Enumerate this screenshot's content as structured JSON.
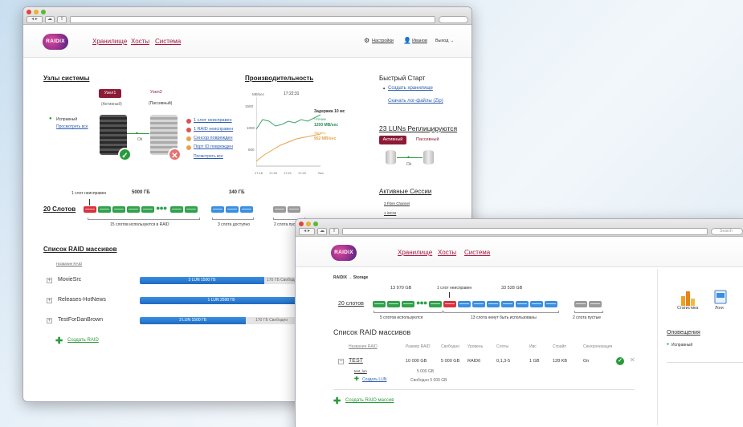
{
  "w1": {
    "nav": [
      "Хранилище",
      "Хосты",
      "Система"
    ],
    "logo": "RAIDIX",
    "user": {
      "settings": "Настройки",
      "name": "Иванов",
      "logout": "Выход →"
    },
    "nodes": {
      "title": "Узлы системы",
      "node1": "Узел1",
      "node1_state": "(Активный)",
      "node2": "Узел2",
      "node2_state": "(Пассивный)",
      "status": "Исправный",
      "view_all": "Просмотреть все",
      "ok": "Ok",
      "errors": [
        "1 слот неисправен",
        "1 RAID неисправен",
        "Сенсор поврежден",
        "Порт ID поврежден"
      ],
      "view_all2": "Посмотреть все"
    },
    "perf": {
      "title": "Производительность",
      "unit": "MB/sec",
      "time": "17:22:31",
      "y": [
        "1500",
        "1000",
        "500"
      ],
      "x": [
        "17:16",
        "17:20",
        "17:21",
        "17:22",
        "Sec"
      ],
      "delay": "Задержка 10 мс",
      "read_lbl": "Чтение",
      "read_val": "1200 MB/sec",
      "write_lbl": "Запись",
      "write_val": "952 MB/sec"
    },
    "quick": {
      "title": "Быстрый Старт",
      "create": "Создать хранилище",
      "logs": "Скачать лог-файлы (Zip)"
    },
    "luns": {
      "title": "23 LUNs Реплицируются",
      "active": "Активный",
      "passive": "Пассивный",
      "ok": "Ok"
    },
    "sessions": {
      "title": "Активные Сессии",
      "items": [
        "3 Fibre Channel",
        "1 iSCSI"
      ]
    },
    "slots": {
      "title": "20 Слотов",
      "broken": "1 слот неисправен",
      "gb1": "5000 ГБ",
      "gb2": "340 ГБ",
      "used": "15 слотов используются в RAID",
      "free": "3 слота доступно",
      "empty": "2 слота пустые"
    },
    "raid": {
      "title": "Список RAID массивов",
      "col": "Название RAID",
      "rows": [
        {
          "name": "MovieSrc",
          "bar": "3 LUN  1500 ГБ",
          "free": "170 ГБ Свободно"
        },
        {
          "name": "Releases-HotNews",
          "bar": "1 LUN  2500 ГБ",
          "free": ""
        },
        {
          "name": "TestForDanBrown",
          "bar": "3 LUN  1500 ГБ",
          "free": "170 ГБ Свободно"
        }
      ],
      "create": "Создать RAID"
    }
  },
  "w2": {
    "nav": [
      "Хранилище",
      "Хосты",
      "Система"
    ],
    "logo": "RAIDIX",
    "breadcrumb": "RAIDIX → Storage",
    "search": "Search",
    "slots": {
      "title": "20 слотов",
      "gb1": "13 970 GB",
      "broken": "1 слот неисправен",
      "gb2": "33 528 GB",
      "used": "5 слотов используются",
      "used2": "13 слота неиут быть использованы",
      "empty": "2 слота пустые"
    },
    "raid_title": "Список RAID массивов",
    "cols": [
      "Название RAID",
      "Размер RAID",
      "Свободно",
      "Уровень",
      "Слоты",
      "Ивс",
      "Страйп",
      "Синхронизация"
    ],
    "row": {
      "name": "TEST",
      "size": "10 000 GB",
      "free": "5 000 GB",
      "level": "RAID6",
      "slots": "0,1,3-5",
      "lun": "1 GB",
      "stripe": "128 KB",
      "sync": "On"
    },
    "sub": {
      "name": "test_lun",
      "val": "5 000 GB",
      "create": "Создать LUN",
      "free": "Свободно 5 000 GB"
    },
    "create": "Создать RAID массив",
    "side": {
      "stats": "Статистика",
      "logs": "Логи",
      "alerts": "Оповещения",
      "ok": "Исправный"
    }
  }
}
